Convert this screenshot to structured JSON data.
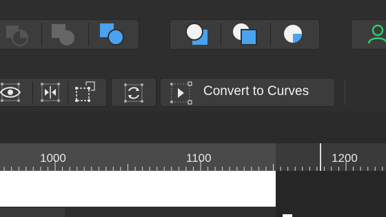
{
  "toolbar": {
    "boolean_ops": [
      "subtract-icon",
      "intersect-icon",
      "divide-icon"
    ],
    "shape_ops": [
      "front-one-back-icon",
      "back-one-front-icon",
      "clip-icon"
    ],
    "user_icon": "person-icon",
    "accent": "#4aa3f0",
    "user_accent": "#2ecc71"
  },
  "context_toolbar": {
    "convert_label": "Convert to Curves"
  },
  "ruler": {
    "labels": [
      "1000",
      "1100",
      "1200"
    ]
  }
}
